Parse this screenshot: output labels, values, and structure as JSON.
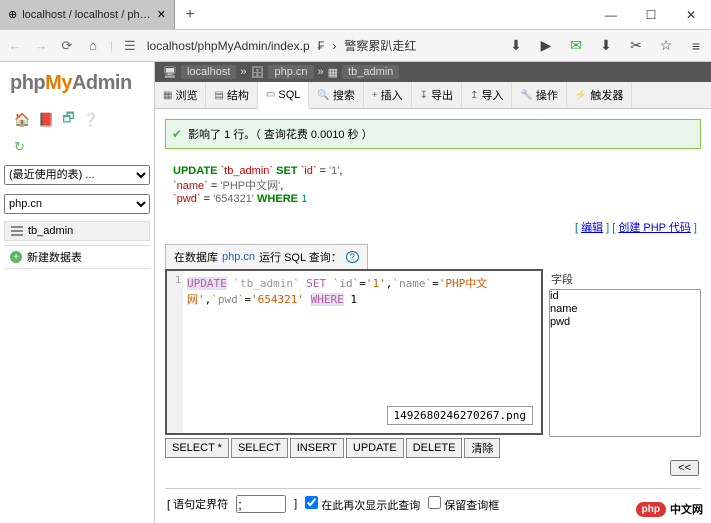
{
  "window": {
    "tab_title": "localhost / localhost / php.cn / tb",
    "plus": "+",
    "controls": {
      "min": "—",
      "max": "☐",
      "close": "✕"
    }
  },
  "nav": {
    "back": "←",
    "fwd": "→",
    "reload": "⟳",
    "home": "⌂",
    "server_icon": "☰",
    "url1": "localhost/phpMyAdmin/index.p",
    "sep1": "₣",
    "sep2": "›",
    "url2": "警察累趴走红",
    "icons": {
      "dl": "⬇",
      "play": "▶",
      "chat": "✉",
      "down2": "⬇",
      "cut": "✂",
      "star": "☆",
      "menu": "≡"
    }
  },
  "sidebar": {
    "logo": {
      "p1": "php",
      "p2": "My",
      "p3": "Admin"
    },
    "icons": {
      "home": "🏠",
      "exit": "📕",
      "sql": "🗗",
      "help": "❔",
      "reload": "↻"
    },
    "recent_label": "(最近使用的表) ...",
    "db": "php.cn",
    "table": "tb_admin",
    "new_table": "新建数据表"
  },
  "breadcrumb": {
    "host": "localhost",
    "db": "php.cn",
    "tbl": "tb_admin"
  },
  "tabs": [
    "浏览",
    "结构",
    "SQL",
    "搜索",
    "插入",
    "导出",
    "导入",
    "操作",
    "触发器"
  ],
  "success": "影响了 1 行。（ 查询花费 0.0010 秒 ）",
  "sql_display": {
    "l1a": "UPDATE",
    "l1b": "`tb_admin`",
    "l1c": "SET",
    "l1d": "`id`",
    "l1e": "=",
    "l1f": "'1'",
    "l2a": "`name`",
    "l2b": "=",
    "l2c": "'PHP中文网'",
    "l3a": "`pwd`",
    "l3b": "=",
    "l3c": "'654321'",
    "l3d": "WHERE",
    "l3e": "1"
  },
  "links": {
    "edit": "编辑",
    "create": "创建 PHP 代码"
  },
  "query": {
    "prefix": "在数据库 ",
    "db": "php.cn",
    "suffix": " 运行 SQL 查询：",
    "line_raw": "UPDATE `tb_admin` SET `id`='1',`name`='PHP中文网',`pwd`='654321' WHERE 1",
    "popup": "1492680246270267.png"
  },
  "fields": {
    "label": "字段",
    "cols": [
      "id",
      "name",
      "pwd"
    ]
  },
  "buttons": {
    "selectall": "SELECT *",
    "select": "SELECT",
    "insert": "INSERT",
    "update": "UPDATE",
    "delete": "DELETE",
    "clear": "清除",
    "scroll": "<<"
  },
  "footer": {
    "delim_label": "[ 语句定界符",
    "delim_val": ";",
    "bracket": "]",
    "show_again": "在此再次显示此查询",
    "keep_box": "保留查询框"
  },
  "watermark": {
    "logo": "php",
    "text": "中文网"
  }
}
